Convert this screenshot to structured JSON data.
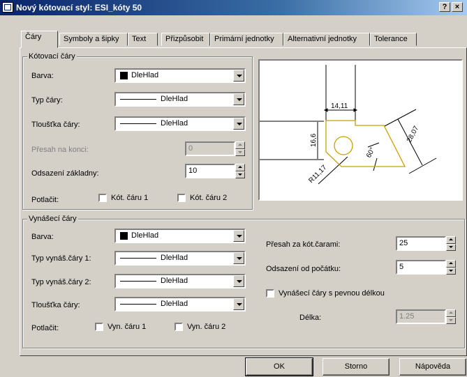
{
  "window": {
    "title": "Nový kótovací styl: ESI_kóty 50",
    "help_label": "?",
    "close_label": "×"
  },
  "tabs": [
    {
      "label": "Čáry",
      "active": true
    },
    {
      "label": "Symboly a šipky"
    },
    {
      "label": "Text"
    },
    {
      "label": "Přizpůsobit"
    },
    {
      "label": "Primární jednotky"
    },
    {
      "label": "Alternativní jednotky"
    },
    {
      "label": "Tolerance"
    }
  ],
  "dim_lines": {
    "legend": "Kótovací čáry",
    "color_label": "Barva:",
    "color_value": "DleHlad",
    "linetype_label": "Typ čáry:",
    "linetype_value": "DleHlad",
    "lineweight_label": "Tloušťka čáry:",
    "lineweight_value": "DleHlad",
    "extend_label": "Přesah na konci:",
    "extend_value": "0",
    "baseline_label": "Odsazení základny:",
    "baseline_value": "10",
    "suppress_label": "Potlačit:",
    "suppress_1": "Kót. čáru 1",
    "suppress_2": "Kót. čáru 2"
  },
  "ext_lines": {
    "legend": "Vynášecí čáry",
    "color_label": "Barva:",
    "color_value": "DleHlad",
    "linetype1_label": "Typ vynáš.čáry 1:",
    "linetype1_value": "DleHlad",
    "linetype2_label": "Typ vynáš.čáry 2:",
    "linetype2_value": "DleHlad",
    "lineweight_label": "Tloušťka čáry:",
    "lineweight_value": "DleHlad",
    "suppress_label": "Potlačit:",
    "suppress_1": "Vyn. čáru 1",
    "suppress_2": "Vyn. čáru 2",
    "extend_label": "Přesah za kót.čarami:",
    "extend_value": "25",
    "offset_label": "Odsazení od počátku:",
    "offset_value": "5",
    "fixed_label": "Vynášecí čáry s pevnou délkou",
    "length_label": "Délka:",
    "length_value": "1.25"
  },
  "preview": {
    "dim_top": "14,11",
    "dim_left": "16,6",
    "dim_right": "28,07",
    "dim_angle": "60°",
    "dim_radius": "R11,17",
    "shape_color": "#c8a000"
  },
  "buttons": {
    "ok": "OK",
    "cancel": "Storno",
    "help": "Nápověda"
  }
}
